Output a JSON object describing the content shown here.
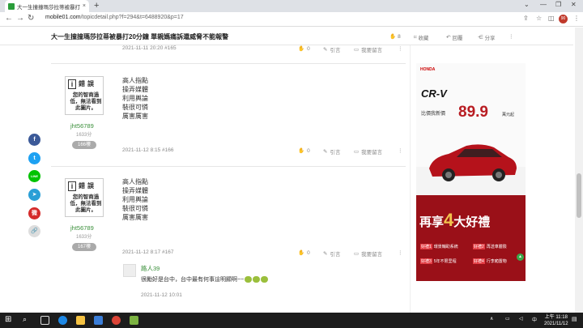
{
  "browser": {
    "tab_title": "大一生撞撞瑪莎拉蒂被暴打20分鐘",
    "tab_close": "×",
    "new_tab": "+",
    "url_host": "mobile01.com",
    "url_path": "/topicdetail.php?f=294&t=6488920&p=17",
    "avatar_text": "90"
  },
  "topic": {
    "title": "大一生撞撞瑪莎拉蒂被暴打20分鐘 單親媽痛訴還威脅不能報警",
    "likes": "8",
    "favorite": "收藏",
    "reply": "回覆",
    "share": "分享"
  },
  "posts": [
    {
      "timestamp": "2021-11-11 20:20 #165",
      "likes": "0",
      "quote": "引言",
      "report": "我要留言"
    },
    {
      "username": "jht56789",
      "score": "1633分",
      "floor": "166樓",
      "lines": [
        "高人指點",
        "操弄媒體",
        "利用輿論",
        "裝很可憐",
        "厲害厲害"
      ],
      "timestamp": "2021-11-12 8:15 #166",
      "likes": "0",
      "quote": "引言",
      "report": "我要留言"
    },
    {
      "username": "jht56789",
      "score": "1633分",
      "floor": "167樓",
      "lines": [
        "高人指點",
        "操弄媒體",
        "利用輿論",
        "裝很可憐",
        "厲害厲害"
      ],
      "timestamp": "2021-11-12 8:17 #167",
      "likes": "0",
      "quote": "引言",
      "report": "我要留言"
    }
  ],
  "avatar_error": {
    "mark": "i",
    "title": "錯誤",
    "message": "您的智商過低，無法看到此圖片。"
  },
  "reply": {
    "username": "路人39",
    "text": "很勵好是台中，台中最有何事這明顯啊~~",
    "timestamp": "2021-11-12 10:01"
  },
  "social": [
    "f",
    "t",
    "LINE",
    "➤",
    "微",
    "🔗"
  ],
  "ad": {
    "brand": "HONDA",
    "model": "CR-V",
    "subtitle": "比價我新價",
    "price": "89.9",
    "unit": "萬元起",
    "promo_a": "再享",
    "promo_b": "4",
    "promo_c": "大好禮",
    "items": [
      {
        "tag": "好禮1",
        "text": "環景輔助系統"
      },
      {
        "tag": "好禮2",
        "text": "再送車體險"
      },
      {
        "tag": "好禮3",
        "text": "5年不限里程"
      },
      {
        "tag": "好禮4",
        "text": "行李廂置物"
      }
    ]
  },
  "taskbar": {
    "time": "上午 11:18",
    "date": "2021/11/12"
  }
}
